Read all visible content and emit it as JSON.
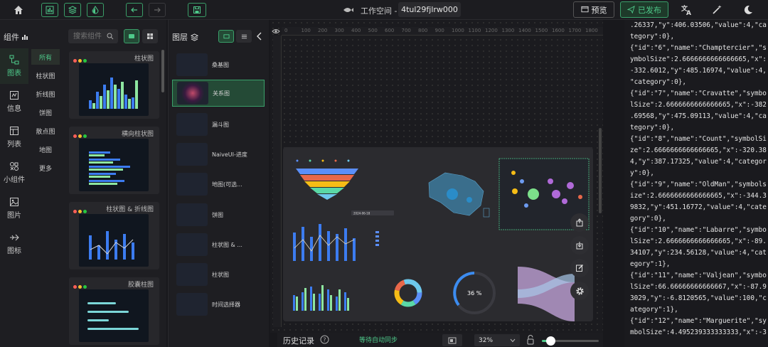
{
  "topbar": {
    "workspace_label": "工作空间 -",
    "project_name": "4tul29fjlrw000",
    "preview_label": "预览",
    "publish_label": "已发布"
  },
  "components_panel": {
    "title": "组件",
    "search_placeholder": "搜索组件",
    "categories": [
      {
        "label": "图表",
        "icon": "chart-icon",
        "active": true
      },
      {
        "label": "信息",
        "icon": "info-icon",
        "active": false
      },
      {
        "label": "列表",
        "icon": "table-icon",
        "active": false
      },
      {
        "label": "小组件",
        "icon": "widget-icon",
        "active": false
      },
      {
        "label": "图片",
        "icon": "image-icon",
        "active": false
      },
      {
        "label": "图标",
        "icon": "plane-icon",
        "active": false
      }
    ],
    "subcategories": [
      "所有",
      "柱状图",
      "折线图",
      "饼图",
      "散点图",
      "地图",
      "更多"
    ],
    "cards": [
      "柱状图",
      "横向柱状图",
      "柱状图 & 折线图",
      "胶囊柱图"
    ]
  },
  "layers_panel": {
    "title": "图层",
    "layers": [
      "桑基图",
      "关系图",
      "漏斗图",
      "NaiveUI-进度",
      "地图(可选...",
      "饼图",
      "柱状图 & ...",
      "柱状图",
      "时间选择器"
    ],
    "selected_index": 1
  },
  "canvas": {
    "ruler_ticks": [
      "0",
      "100",
      "200",
      "300",
      "400",
      "500",
      "600",
      "700",
      "800",
      "900",
      "1000",
      "1100",
      "1200",
      "1300",
      "1400",
      "1500",
      "1600",
      "1700",
      "1800"
    ],
    "progress_label": "36 %",
    "date_value": "2024-06-18"
  },
  "bottombar": {
    "history_label": "历史记录",
    "sync_status": "等待自动同步",
    "zoom_value": "32%"
  },
  "code_lines": [
    ".26337,\"y\":406.03506,\"value\":4,\"ca",
    "tegory\":0},",
    "{\"id\":\"6\",\"name\":\"Champtercier\",\"s",
    "ymbolSize\":2.6666666666666665,\"x\":",
    "-332.6012,\"y\":485.16974,\"value\":4,",
    "\"category\":0},",
    "{\"id\":\"7\",\"name\":\"Cravatte\",\"symbo",
    "lSize\":2.6666666666666665,\"x\":-382",
    ".69568,\"y\":475.09113,\"value\":4,\"ca",
    "tegory\":0},",
    "{\"id\":\"8\",\"name\":\"Count\",\"symbolSi",
    "ze\":2.6666666666666665,\"x\":-320.38",
    "4,\"y\":387.17325,\"value\":4,\"categor",
    "y\":0},",
    "{\"id\":\"9\",\"name\":\"OldMan\",\"symbols",
    "ize\":2.6666666666666665,\"x\":-344.3",
    "9832,\"y\":451.16772,\"value\":4,\"cate",
    "gory\":0},",
    "{\"id\":\"10\",\"name\":\"Labarre\",\"symbo",
    "lSize\":2.6666666666666665,\"x\":-89.",
    "34107,\"y\":234.56128,\"value\":4,\"cat",
    "egory\":1},",
    "{\"id\":\"11\",\"name\":\"Valjean\",\"symbo",
    "lSize\":66.66666666666667,\"x\":-87.9",
    "3029,\"y\":-6.8120565,\"value\":100,\"c",
    "ategory\":1},",
    "{\"id\":\"12\",\"name\":\"Marguerite\",\"sy",
    "mbolSize\":4.495239333333333,\"x\":-3"
  ],
  "colors": {
    "accent": "#4ec98a",
    "bg": "#18181c",
    "panel": "#1c1c20"
  }
}
